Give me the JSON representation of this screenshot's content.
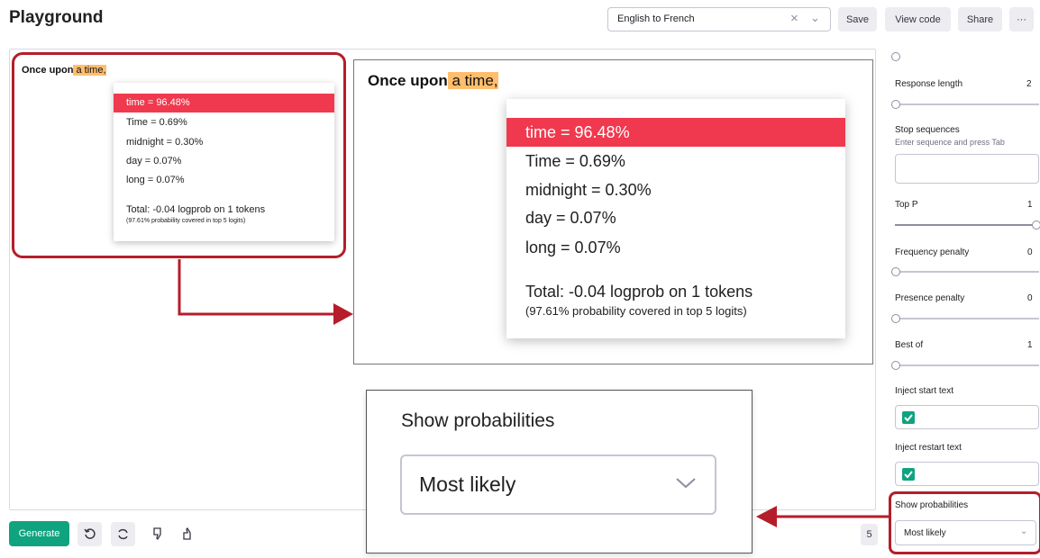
{
  "header": {
    "title": "Playground",
    "preset_value": "English to French",
    "clear_glyph": "×",
    "chevron_glyph": "⌄",
    "buttons": {
      "save": "Save",
      "view_code": "View code",
      "share": "Share",
      "more": "···"
    }
  },
  "editor": {
    "prompt_plain": "Once upon",
    "prompt_highlight": " a time,"
  },
  "logprobs_popup": {
    "selected": "time = 96.48%",
    "options": [
      "Time = 0.69%",
      "midnight = 0.30%",
      "day = 0.07%",
      "long = 0.07%"
    ],
    "total": "Total: -0.04 logprob on 1 tokens",
    "coverage": "(97.61% probability covered in top 5 logits)"
  },
  "show_probabilities_zoom": {
    "label": "Show probabilities",
    "value": "Most likely"
  },
  "toolbar": {
    "generate": "Generate",
    "token_count": "5"
  },
  "sidebar": {
    "response_length": {
      "label": "Response length",
      "value": "2"
    },
    "stop_sequences": {
      "label": "Stop sequences",
      "hint": "Enter sequence and press Tab"
    },
    "top_p": {
      "label": "Top P",
      "value": "1"
    },
    "frequency_penalty": {
      "label": "Frequency penalty",
      "value": "0"
    },
    "presence_penalty": {
      "label": "Presence penalty",
      "value": "0"
    },
    "best_of": {
      "label": "Best of",
      "value": "1"
    },
    "inject_start": {
      "label": "Inject start text",
      "checked": true
    },
    "inject_restart": {
      "label": "Inject restart text",
      "checked": true
    },
    "show_probabilities": {
      "label": "Show probabilities",
      "value": "Most likely",
      "chevron_glyph": "⌄"
    }
  },
  "colors": {
    "accent_green": "#10a37f",
    "highlight_orange": "#ffbe6e",
    "selection_red": "#f0394e",
    "annotation_red": "#b51d2a"
  }
}
